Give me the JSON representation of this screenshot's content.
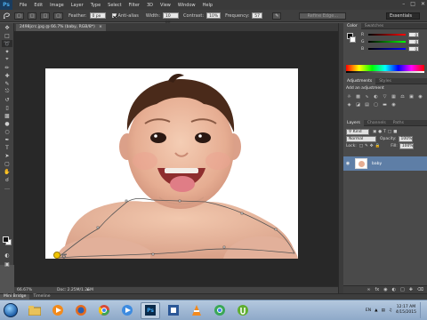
{
  "menubar": {
    "logo": "Ps",
    "items": [
      "File",
      "Edit",
      "Image",
      "Layer",
      "Type",
      "Select",
      "Filter",
      "3D",
      "View",
      "Window",
      "Help"
    ]
  },
  "options": {
    "feather_label": "Feather:",
    "feather_value": "0 px",
    "antialias_label": "Anti-alias",
    "width_label": "Width:",
    "width_value": "10 px",
    "contrast_label": "Contrast:",
    "contrast_value": "10%",
    "frequency_label": "Frequency:",
    "frequency_value": "57",
    "refine_label": "Refine Edge...",
    "workspace": "Essentials"
  },
  "document": {
    "tab_label": "2498jcrc.jpg @ 66.7% (baby, RGB/8*)",
    "zoom": "66.67%",
    "doc_info": "Doc: 2.25M/1.25M"
  },
  "bottom_tabs": [
    "Mini Bridge",
    "Timeline"
  ],
  "color_panel": {
    "tabs": [
      "Color",
      "Swatches"
    ],
    "channels": [
      {
        "label": "R",
        "value": "0",
        "grad": "linear-gradient(to right,#000,#f00)"
      },
      {
        "label": "G",
        "value": "0",
        "grad": "linear-gradient(to right,#000,#0f0)"
      },
      {
        "label": "B",
        "value": "0",
        "grad": "linear-gradient(to right,#000,#00f)"
      }
    ]
  },
  "adjustments": {
    "tabs": [
      "Adjustments",
      "Styles"
    ],
    "title": "Add an adjustment"
  },
  "layers": {
    "tabs": [
      "Layers",
      "Channels",
      "Paths"
    ],
    "kind_label": "Kind",
    "blend_mode": "Normal",
    "opacity_label": "Opacity:",
    "opacity_value": "100%",
    "lock_label": "Lock:",
    "fill_label": "Fill:",
    "fill_value": "100%",
    "layer_name": "baby"
  },
  "taskbar": {
    "lang": "EN",
    "time": "12:17 AM",
    "date": "4/15/2015"
  },
  "colors": {
    "selected_layer": "#5e7ea6",
    "canvas_bg": "#ffffff",
    "workspace_bg": "#282828",
    "panel_bg": "#4a4a4a"
  }
}
